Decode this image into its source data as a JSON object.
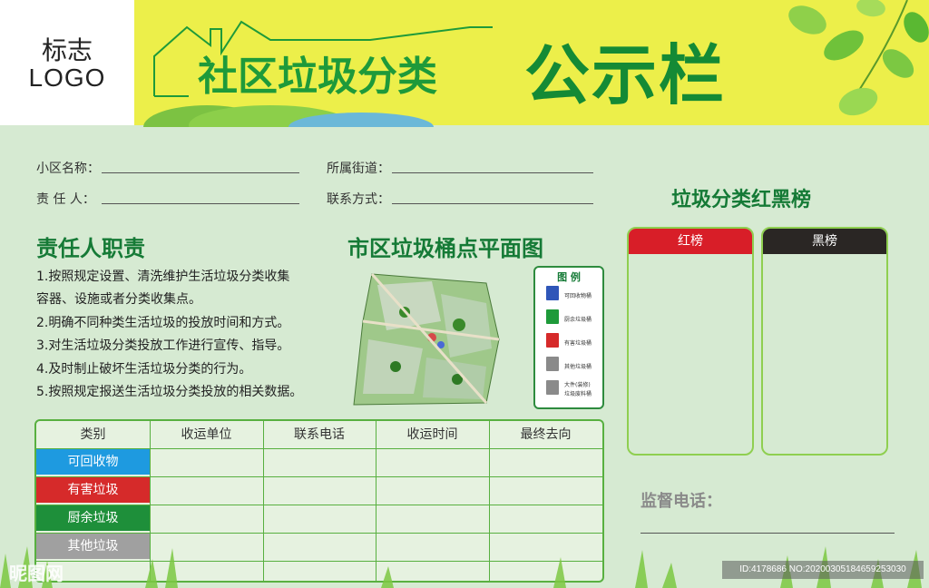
{
  "logo": {
    "line1": "标志",
    "line2": "LOGO"
  },
  "header": {
    "subtitle": "社区垃圾分类",
    "title": "公示栏"
  },
  "info": {
    "community_label": "小区名称：",
    "street_label": "所属街道：",
    "person_label": "责  任  人：",
    "contact_label": "联系方式："
  },
  "duties": {
    "title": "责任人职责",
    "items": [
      "1.按照规定设置、清洗维护生活垃圾分类收集",
      "容器、设施或者分类收集点。",
      "2.明确不同种类生活垃圾的投放时间和方式。",
      "3.对生活垃圾分类投放工作进行宣传、指导。",
      "4.及时制止破坏生活垃圾分类的行为。",
      "5.按照规定报送生活垃圾分类投放的相关数据。"
    ]
  },
  "map": {
    "title": "市区垃圾桶点平面图",
    "legend_title": "图 例",
    "legend": [
      {
        "label": "可回收物桶",
        "color": "#2f56b8"
      },
      {
        "label": "厨余垃圾桶",
        "color": "#1e9a3a"
      },
      {
        "label": "有害垃圾桶",
        "color": "#d62a2a"
      },
      {
        "label": "其他垃圾桶",
        "color": "#8a8a8a"
      },
      {
        "label": "大件(装修)",
        "color": "#8a8a8a"
      }
    ],
    "legend_extra": "垃圾废料桶"
  },
  "table": {
    "headers": [
      "类别",
      "收运单位",
      "联系电话",
      "收运时间",
      "最终去向"
    ],
    "categories": [
      {
        "label": "可回收物",
        "color": "#1e9ae0"
      },
      {
        "label": "有害垃圾",
        "color": "#d62a2a"
      },
      {
        "label": "厨余垃圾",
        "color": "#1e8f3a"
      },
      {
        "label": "其他垃圾",
        "color": "#a0a0a0"
      }
    ]
  },
  "board": {
    "title": "垃圾分类红黑榜",
    "red_label": "红榜",
    "black_label": "黑榜",
    "red_color": "#d81e28",
    "black_color": "#2a2624"
  },
  "supervision": {
    "label": "监督电话："
  },
  "watermark": {
    "left": "昵图网",
    "right": "ID:4178686 NO:20200305184659253030"
  }
}
